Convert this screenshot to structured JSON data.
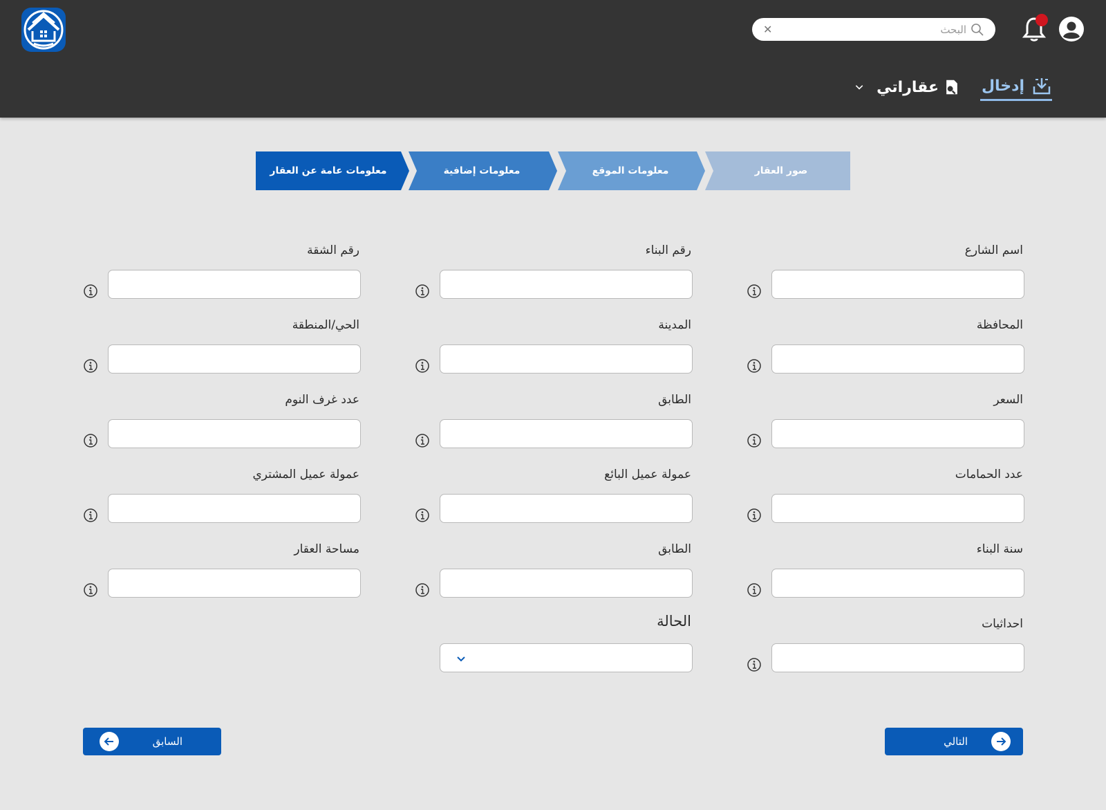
{
  "header": {
    "search": {
      "placeholder": "البحث",
      "value": ""
    },
    "nav": {
      "entry_label": "إدخال",
      "my_properties_label": "عقاراتي"
    },
    "colors": {
      "bar": "#343434",
      "accent": "#0a5bb7",
      "notification_dot": "#d0161f"
    }
  },
  "stepper": {
    "steps": [
      {
        "label": "معلومات عامة عن العقار",
        "state": "active",
        "color": "#0a5bb7"
      },
      {
        "label": "معلومات إضافية",
        "state": "upcoming",
        "color": "#3a7ec6"
      },
      {
        "label": "معلومات الموقع",
        "state": "upcoming",
        "color": "#6a9ed3"
      },
      {
        "label": "صور العقار",
        "state": "upcoming",
        "color": "#a4bcd9"
      }
    ]
  },
  "form": {
    "fields": [
      {
        "label": "اسم الشارع",
        "value": ""
      },
      {
        "label": "رقم البناء",
        "value": ""
      },
      {
        "label": "رقم الشقة",
        "value": ""
      },
      {
        "label": "المحافظة",
        "value": ""
      },
      {
        "label": "المدينة",
        "value": ""
      },
      {
        "label": "الحي/المنطقة",
        "value": ""
      },
      {
        "label": "السعر",
        "value": ""
      },
      {
        "label": "الطابق",
        "value": ""
      },
      {
        "label": "عدد غرف النوم",
        "value": ""
      },
      {
        "label": "عدد الحمامات",
        "value": ""
      },
      {
        "label": "عمولة عميل البائع",
        "value": ""
      },
      {
        "label": "عمولة عميل المشتري",
        "value": ""
      },
      {
        "label": "سنة البناء",
        "value": ""
      },
      {
        "label": "الطابق",
        "value": ""
      },
      {
        "label": "مساحة العقار",
        "value": ""
      },
      {
        "label": "احداثيات",
        "value": ""
      }
    ],
    "status": {
      "label": "الحالة",
      "selected": ""
    }
  },
  "actions": {
    "next_label": "التالي",
    "previous_label": "السابق"
  }
}
